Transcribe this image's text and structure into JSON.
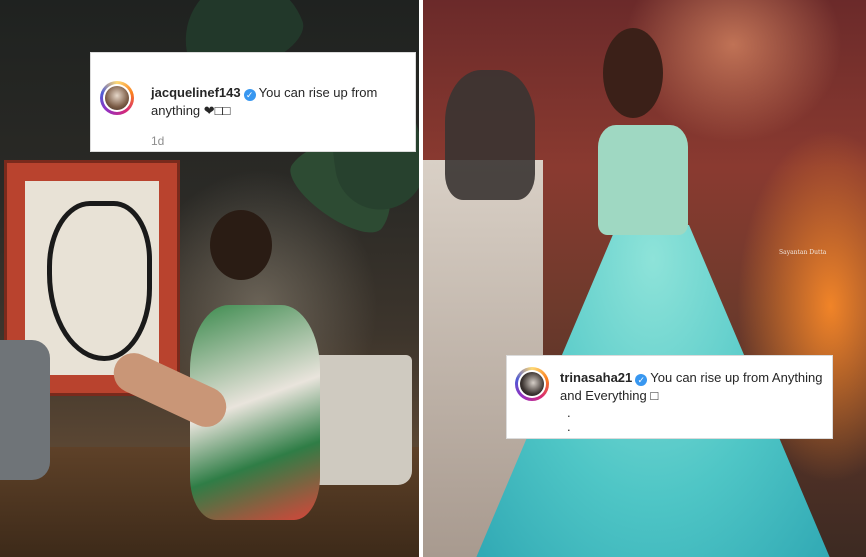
{
  "left_post": {
    "comment": {
      "username": "jacquelinef143",
      "verified_icon": "verified-badge-icon",
      "text": "You can rise up from anything ❤□□",
      "timestamp": "1d"
    }
  },
  "right_post": {
    "photo_credit": "Sayantan Dutta",
    "comment": {
      "username": "trinasaha21",
      "verified_icon": "verified-badge-icon",
      "text": "You can rise up from Anything and Everything □",
      "continuation_line_1": ".",
      "continuation_line_2": "."
    }
  },
  "colors": {
    "verified_blue": "#3897f0",
    "username_text": "#262626",
    "timestamp_gray": "#8e8e8e"
  }
}
